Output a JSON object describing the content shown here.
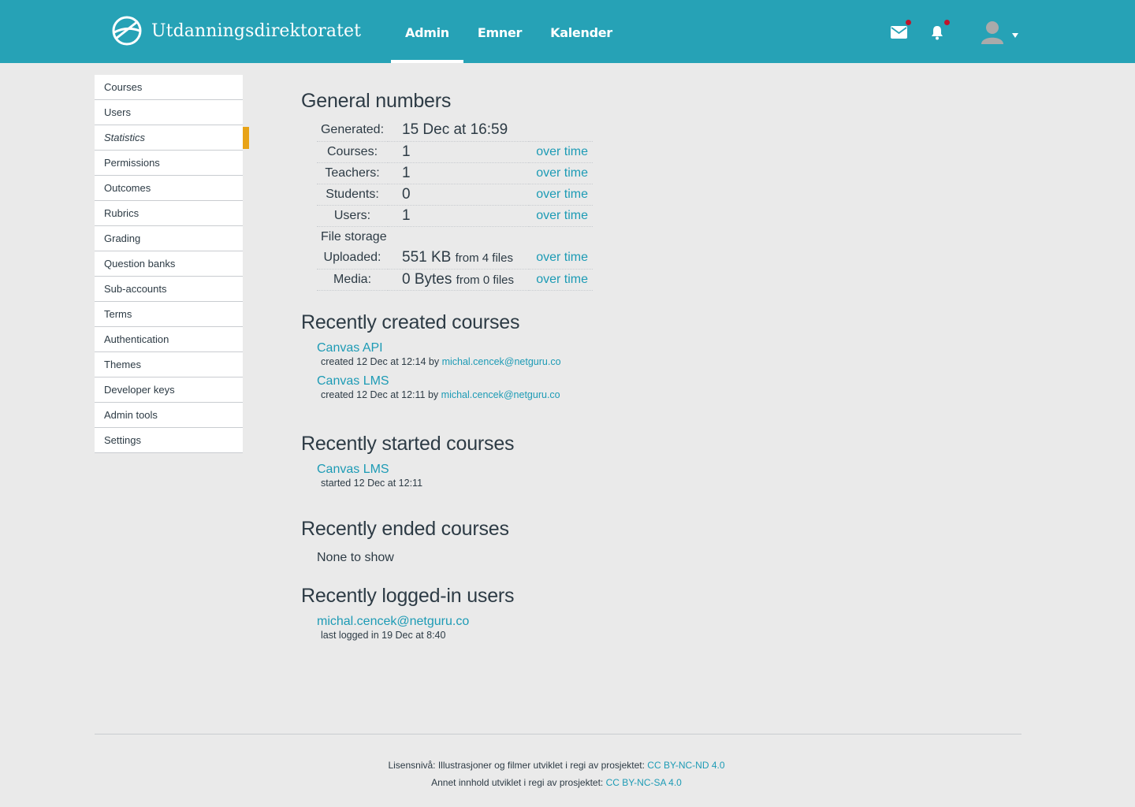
{
  "brand": {
    "name": "Utdanningsdirektoratet"
  },
  "nav": {
    "items": [
      {
        "label": "Admin",
        "active": true
      },
      {
        "label": "Emner"
      },
      {
        "label": "Kalender"
      }
    ]
  },
  "header_icons": {
    "mail": "mail-icon",
    "notifications": "bell-icon",
    "avatar": "avatar-icon",
    "notification_dot_color": "#c0152a"
  },
  "sidebar": {
    "items": [
      {
        "label": "Courses"
      },
      {
        "label": "Users"
      },
      {
        "label": "Statistics",
        "active": true
      },
      {
        "label": "Permissions"
      },
      {
        "label": "Outcomes"
      },
      {
        "label": "Rubrics"
      },
      {
        "label": "Grading"
      },
      {
        "label": "Question banks"
      },
      {
        "label": "Sub-accounts"
      },
      {
        "label": "Terms"
      },
      {
        "label": "Authentication"
      },
      {
        "label": "Themes"
      },
      {
        "label": "Developer keys"
      },
      {
        "label": "Admin tools"
      },
      {
        "label": "Settings"
      }
    ]
  },
  "general": {
    "title": "General numbers",
    "generated_label": "Generated:",
    "generated_value": "15 Dec at 16:59",
    "over_time": "over time",
    "courses_label": "Courses:",
    "courses_value": "1",
    "teachers_label": "Teachers:",
    "teachers_value": "1",
    "students_label": "Students:",
    "students_value": "0",
    "users_label": "Users:",
    "users_value": "1",
    "file_storage_label": "File storage",
    "uploaded_label": "Uploaded:",
    "uploaded_value": "551 KB",
    "uploaded_files": "from 4 files",
    "media_label": "Media:",
    "media_value": "0 Bytes",
    "media_files": "from 0 files"
  },
  "recent_created": {
    "title": "Recently created courses",
    "courses": [
      {
        "name": "Canvas API",
        "meta": "created 12 Dec at 12:14 by",
        "user": "michal.cencek@netguru.co"
      },
      {
        "name": "Canvas LMS",
        "meta": "created 12 Dec at 12:11 by",
        "user": "michal.cencek@netguru.co"
      }
    ]
  },
  "recent_started": {
    "title": "Recently started courses",
    "courses": [
      {
        "name": "Canvas LMS",
        "meta": "started 12 Dec at 12:11"
      }
    ]
  },
  "recent_ended": {
    "title": "Recently ended courses",
    "empty": "None to show"
  },
  "recent_users": {
    "title": "Recently logged-in users",
    "users": [
      {
        "name": "michal.cencek@netguru.co",
        "meta": "last logged in 19 Dec at 8:40"
      }
    ]
  },
  "footer": {
    "line1_text": "Lisensnivå: Illustrasjoner og filmer utviklet i regi av prosjektet:",
    "line1_link": "CC BY-NC-ND 4.0",
    "line2_text": "Annet innhold utviklet i regi av prosjektet:",
    "line2_link": "CC BY-NC-SA 4.0"
  },
  "colors": {
    "header": "#26a2b6",
    "link": "#1d9bb5",
    "active_marker": "#e8a317",
    "background": "#eaeaea"
  }
}
